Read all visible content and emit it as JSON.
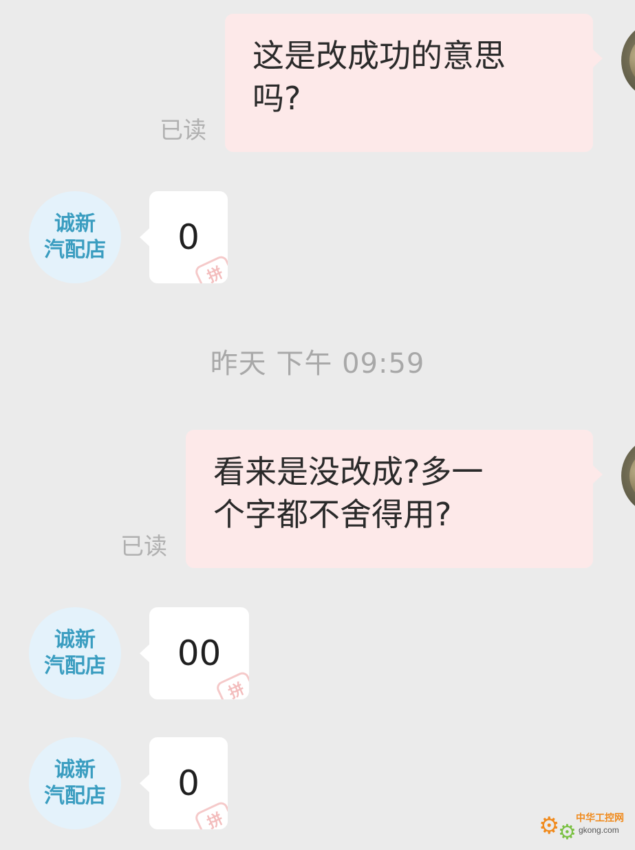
{
  "messages": [
    {
      "from": "me",
      "lines": [
        "这是改成功的意思",
        "吗?"
      ],
      "status": "已读"
    },
    {
      "from": "shop",
      "avatar_lines": [
        "诚新",
        "汽配店"
      ],
      "text": "0",
      "mark": "拼"
    },
    {
      "from": "me",
      "lines": [
        "看来是没改成?多一",
        "个字都不舍得用?"
      ],
      "status": "已读"
    },
    {
      "from": "shop",
      "avatar_lines": [
        "诚新",
        "汽配店"
      ],
      "text": "00",
      "mark": "拼"
    },
    {
      "from": "shop",
      "avatar_lines": [
        "诚新",
        "汽配店"
      ],
      "text": "0",
      "mark": "拼"
    }
  ],
  "time_divider": "昨天 下午 09:59",
  "watermark": {
    "title": "中华工控网",
    "domain": "gkong.com",
    "icon": "gear-icon"
  },
  "colors": {
    "background": "#ebebeb",
    "sent_bubble": "#fde9e9",
    "received_bubble": "#ffffff",
    "shop_avatar_bg": "#e4f2fb",
    "shop_avatar_text": "#3a9dc0",
    "read_status": "#b0b0b0"
  }
}
